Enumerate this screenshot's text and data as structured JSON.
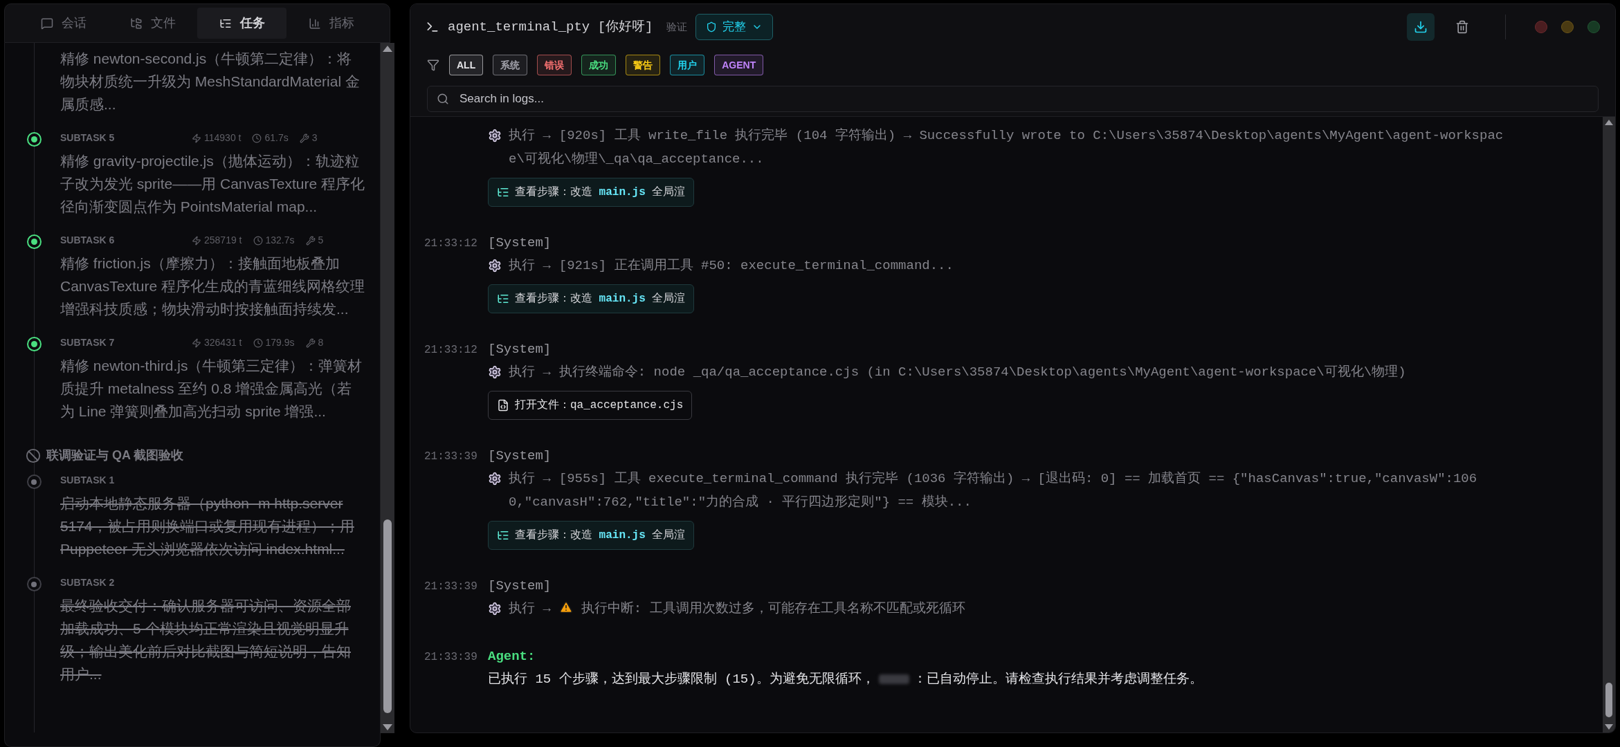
{
  "sidebar": {
    "tabs": [
      {
        "label": "会话",
        "selected": false
      },
      {
        "label": "文件",
        "selected": false
      },
      {
        "label": "任务",
        "selected": true
      },
      {
        "label": "指标",
        "selected": false
      }
    ],
    "items": [
      {
        "kind": "subtask",
        "cancelled": false,
        "description": "精修 newton-second.js（牛顿第二定律）：将物块材质统一升级为 MeshStandardMaterial 金属质感..."
      },
      {
        "kind": "subtask",
        "cancelled": false,
        "label": "SUBTASK 5",
        "tokens": "114930 t",
        "time": "61.7s",
        "tools": "3",
        "description": "精修 gravity-projectile.js（抛体运动）：轨迹粒子改为发光 sprite——用 CanvasTexture 程序化径向渐变圆点作为 PointsMaterial map..."
      },
      {
        "kind": "subtask",
        "cancelled": false,
        "label": "SUBTASK 6",
        "tokens": "258719 t",
        "time": "132.7s",
        "tools": "5",
        "description": "精修 friction.js（摩擦力）：接触面地板叠加 CanvasTexture 程序化生成的青蓝细线网格纹理增强科技质感；物块滑动时按接触面持续发..."
      },
      {
        "kind": "subtask",
        "cancelled": false,
        "label": "SUBTASK 7",
        "tokens": "326431 t",
        "time": "179.9s",
        "tools": "8",
        "description": "精修 newton-third.js（牛顿第三定律）：弹簧材质提升 metalness 至约 0.8 增强金属高光（若为 Line 弹簧则叠加高光扫动 sprite 增强..."
      },
      {
        "kind": "group",
        "cancelled": true,
        "label": "联调验证与 QA 截图验收"
      },
      {
        "kind": "subtask",
        "cancelled": true,
        "label": "SUBTASK 1",
        "description": "启动本地静态服务器（python -m http.server 5174，被占用则换端口或复用现有进程）；用 Puppeteer 无头浏览器依次访问 index.html..."
      },
      {
        "kind": "subtask",
        "cancelled": true,
        "label": "SUBTASK 2",
        "description": "最终验收交付：确认服务器可访问、资源全部加载成功、5 个模块均正常渲染且视觉明显升级；输出美化前后对比截图与简短说明，告知用户..."
      }
    ]
  },
  "terminal": {
    "title": "agent_terminal_pty [你好呀]",
    "verify_label": "验证",
    "verify_mode": "完整",
    "filters": [
      {
        "label": "ALL",
        "color": "#e4e4e7"
      },
      {
        "label": "系统",
        "color": "#a1a1aa"
      },
      {
        "label": "错误",
        "color": "#f87171"
      },
      {
        "label": "成功",
        "color": "#4ade80"
      },
      {
        "label": "警告",
        "color": "#facc15"
      },
      {
        "label": "用户",
        "color": "#22d3ee"
      },
      {
        "label": "AGENT",
        "color": "#c084fc"
      }
    ],
    "search": {
      "placeholder": "Search in logs..."
    },
    "logs": [
      {
        "kind": "system",
        "prefix": "执行 →",
        "warning": false,
        "text": "[920s] 工具 write_file 执行完毕 (104 字符输出) → Successfully wrote to C:\\Users\\35874\\Desktop\\agents\\MyAgent\\agent-workspace\\可视化\\物理\\_qa\\qa_acceptance...",
        "action": {
          "kind": "steps",
          "label": "查看步骤：改造 **main.js** 全局渲"
        }
      },
      {
        "kind": "system",
        "time": "21:33:12",
        "source": "[System]",
        "prefix": "执行 →",
        "warning": false,
        "text": "[921s] 正在调用工具 #50: execute_terminal_command...",
        "action": {
          "kind": "steps",
          "label": "查看步骤：改造 **main.js** 全局渲"
        }
      },
      {
        "kind": "system",
        "time": "21:33:12",
        "source": "[System]",
        "prefix": "执行 →",
        "warning": false,
        "text": "执行终端命令: node _qa/qa_acceptance.cjs (in C:\\Users\\35874\\Desktop\\agents\\MyAgent\\agent-workspace\\可视化\\物理)",
        "action": {
          "kind": "file",
          "label": "打开文件：qa_acceptance.cjs"
        }
      },
      {
        "kind": "system",
        "time": "21:33:39",
        "source": "[System]",
        "prefix": "执行 →",
        "warning": false,
        "text": "[955s] 工具 execute_terminal_command 执行完毕 (1036 字符输出) → [退出码: 0] == 加载首页 == {\"hasCanvas\":true,\"canvasW\":1060,\"canvasH\":762,\"title\":\"力的合成 · 平行四边形定则\"} == 模块...",
        "action": {
          "kind": "steps",
          "label": "查看步骤：改造 **main.js** 全局渲"
        }
      },
      {
        "kind": "system",
        "time": "21:33:39",
        "source": "[System]",
        "prefix": "执行 →",
        "warning": true,
        "text": "执行中断: 工具调用次数过多，可能存在工具名称不匹配或死循环"
      },
      {
        "kind": "agent",
        "time": "21:33:39",
        "source": "Agent:",
        "text": "已执行 15 个步骤，达到最大步骤限制 (15)。为避免无限循环，",
        "redacted": true,
        "text_after": "：已自动停止。请检查执行结果并考虑调整任务。"
      }
    ]
  }
}
